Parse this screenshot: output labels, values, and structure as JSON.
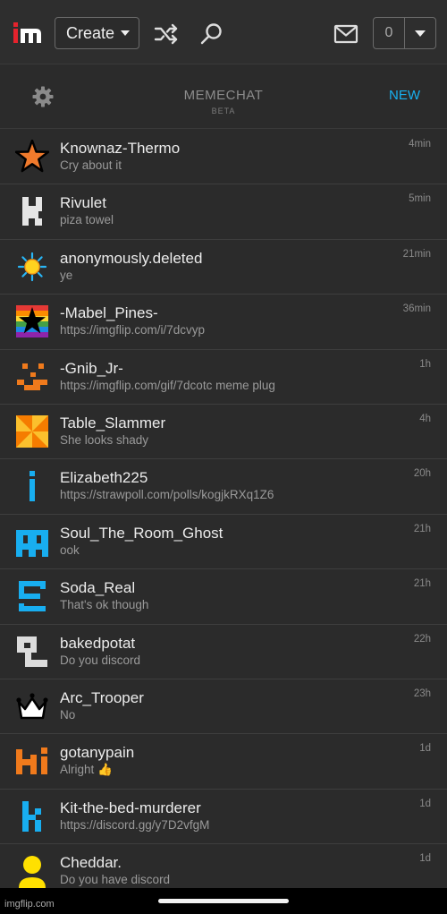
{
  "nav": {
    "create_label": "Create",
    "notification_count": "0"
  },
  "chat_header": {
    "title": "MEMECHAT",
    "subtitle": "BETA",
    "new_label": "NEW"
  },
  "chats": [
    {
      "name": "Knownaz-Thermo",
      "message": "Cry about it",
      "time": "4min",
      "avatar": "orange-star-icon"
    },
    {
      "name": "Rivulet",
      "message": "piza towel",
      "time": "5min",
      "avatar": "gray-pixel-icon"
    },
    {
      "name": "anonymously.deleted",
      "message": "ye",
      "time": "21min",
      "avatar": "sun-icon"
    },
    {
      "name": "-Mabel_Pines-",
      "message": "https://imgflip.com/i/7dcvyp",
      "time": "36min",
      "avatar": "rainbow-star-icon"
    },
    {
      "name": "-Gnib_Jr-",
      "message": "https://imgflip.com/gif/7dcotc meme plug",
      "time": "1h",
      "avatar": "orange-pixel-face-icon"
    },
    {
      "name": "Table_Slammer",
      "message": "She looks shady",
      "time": "4h",
      "avatar": "pinwheel-icon"
    },
    {
      "name": "Elizabeth225",
      "message": "https://strawpoll.com/polls/kogjkRXq1Z6",
      "time": "20h",
      "avatar": "blue-i-icon"
    },
    {
      "name": "Soul_The_Room_Ghost",
      "message": "ook",
      "time": "21h",
      "avatar": "blue-ghost-icon"
    },
    {
      "name": "Soda_Real",
      "message": "That's ok though",
      "time": "21h",
      "avatar": "blue-square-icon"
    },
    {
      "name": "bakedpotat",
      "message": "Do you discord",
      "time": "22h",
      "avatar": "gray-block-icon"
    },
    {
      "name": "Arc_Trooper",
      "message": "No",
      "time": "23h",
      "avatar": "crown-icon"
    },
    {
      "name": "gotanypain",
      "message": "Alright 👍",
      "time": "1d",
      "avatar": "orange-hi-icon"
    },
    {
      "name": "Kit-the-bed-murderer",
      "message": "https://discord.gg/y7D2vfgM",
      "time": "1d",
      "avatar": "blue-k-icon"
    },
    {
      "name": "Cheddar.",
      "message": "Do you have discord",
      "time": "1d",
      "avatar": "yellow-person-icon"
    }
  ],
  "footer": {
    "watermark": "imgflip.com"
  },
  "colors": {
    "background": "#2b2b2b",
    "accent": "#18b1f0",
    "logo_red": "#e5232d"
  }
}
